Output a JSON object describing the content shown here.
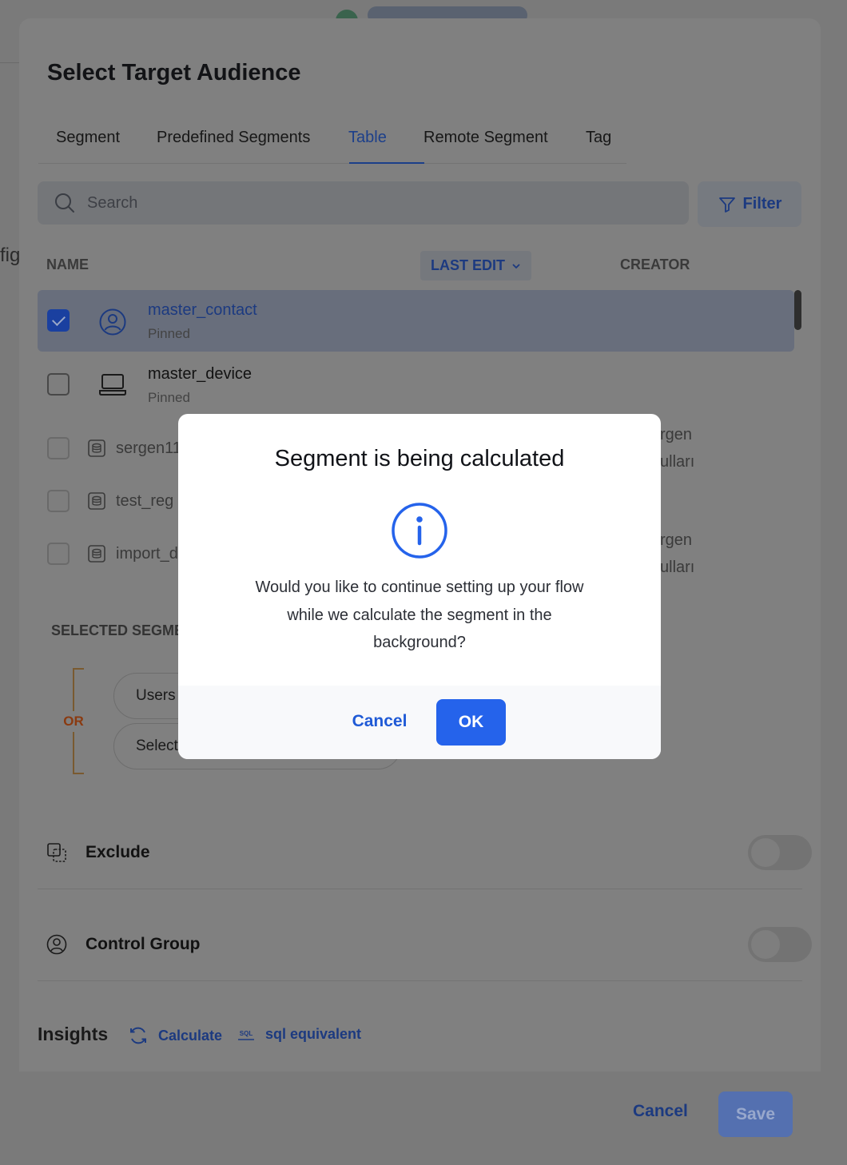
{
  "background": {
    "fragment_text": "fig"
  },
  "dialog": {
    "title": "Select Target Audience",
    "tabs": [
      {
        "label": "Segment",
        "active": false
      },
      {
        "label": "Predefined Segments",
        "active": false
      },
      {
        "label": "Table",
        "active": true
      },
      {
        "label": "Remote Segment",
        "active": false
      },
      {
        "label": "Tag",
        "active": false
      }
    ],
    "search": {
      "placeholder": "Search",
      "value": ""
    },
    "filter_label": "Filter",
    "columns": {
      "name": "NAME",
      "last_edit": "LAST EDIT",
      "creator": "CREATOR"
    },
    "rows": [
      {
        "name": "master_contact",
        "sub": "Pinned",
        "checked": true,
        "icon": "user-circle-icon"
      },
      {
        "name": "master_device",
        "sub": "Pinned",
        "checked": false,
        "icon": "laptop-icon"
      },
      {
        "name": "sergen11",
        "checked": false,
        "icon": "database-icon",
        "creator_line1": "rgen",
        "creator_line2": "ulları"
      },
      {
        "name": "test_reg",
        "checked": false,
        "icon": "database-icon"
      },
      {
        "name": "import_d",
        "checked": false,
        "icon": "database-icon",
        "creator_line1": "rgen",
        "creator_line2": "ulları"
      }
    ],
    "selected_heading": "SELECTED SEGME",
    "or_label": "OR",
    "selected_segments": [
      "Users",
      "Select"
    ],
    "exclude_label": "Exclude",
    "control_group_label": "Control Group",
    "insights": {
      "title": "Insights",
      "calculate": "Calculate",
      "sql": "sql equivalent",
      "sql_icon_text": "SQL"
    },
    "footer": {
      "cancel": "Cancel",
      "save": "Save"
    }
  },
  "modal": {
    "title": "Segment is being calculated",
    "message": "Would you like to continue setting up your flow while we calculate the segment in the background?",
    "cancel": "Cancel",
    "ok": "OK"
  },
  "colors": {
    "accent": "#2563eb",
    "overlay": "#808080"
  }
}
